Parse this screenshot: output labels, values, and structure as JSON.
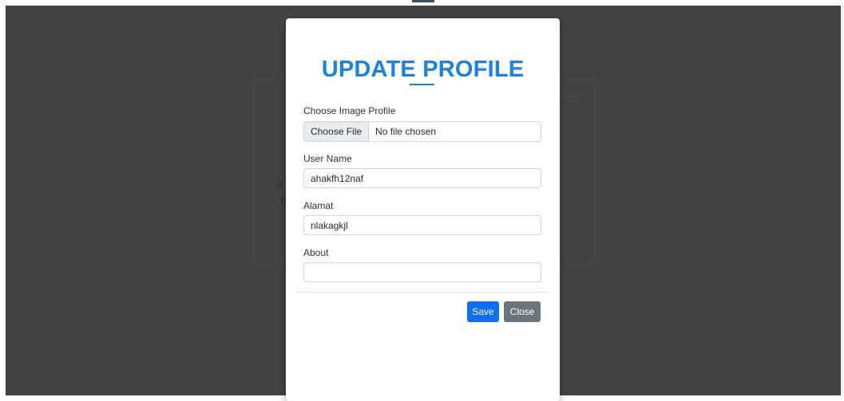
{
  "modal": {
    "title": "UPDATE PROFILE",
    "image_label": "Choose Image Profile",
    "file_button": "Choose File",
    "file_status": "No file chosen",
    "username_label": "User Name",
    "username_value": "ahakfh12naf",
    "alamat_label": "Alamat",
    "alamat_value": "nlakagkjl",
    "about_label": "About",
    "about_value": "",
    "save_label": "Save",
    "close_label": "Close"
  },
  "background": {
    "fragment_1": "a",
    "fragment_2": "e"
  },
  "colors": {
    "accent": "#1a82e2",
    "primary_button": "#0d6efd",
    "secondary_button": "#6c757d",
    "backdrop": "#434343"
  }
}
